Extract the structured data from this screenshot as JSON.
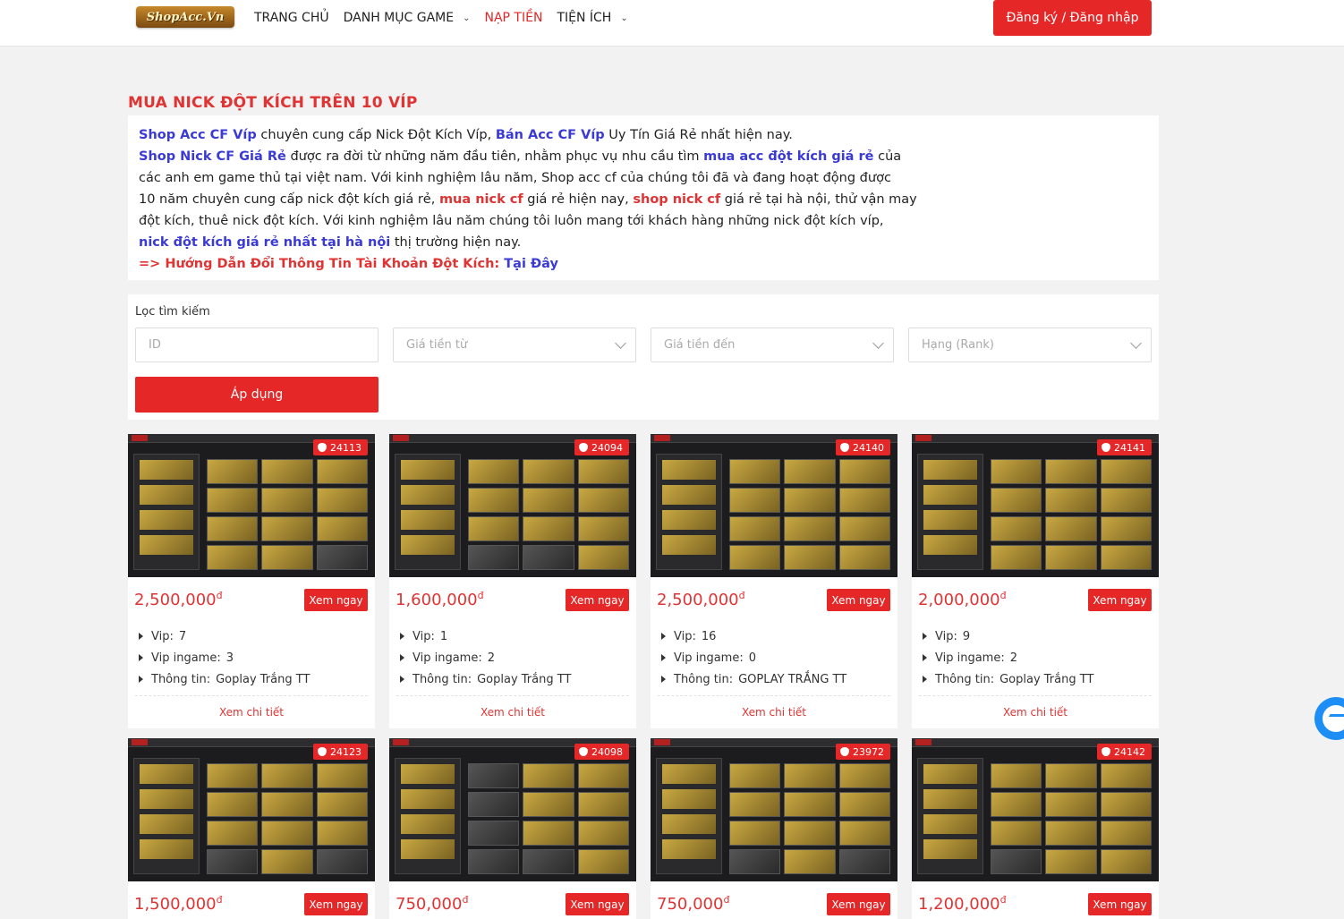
{
  "header": {
    "logo_text": "ShopAcc.Vn",
    "nav": [
      {
        "label": "TRANG CHỦ",
        "has_dropdown": false,
        "active": false
      },
      {
        "label": "DANH MỤC GAME",
        "has_dropdown": true,
        "active": false
      },
      {
        "label": "NẠP TIỀN",
        "has_dropdown": false,
        "active": true
      },
      {
        "label": "TIỆN ÍCH",
        "has_dropdown": true,
        "active": false
      }
    ],
    "login_label": "Đăng ký / Đăng nhập"
  },
  "page_title": "MUA NICK ĐỘT KÍCH TRÊN 10 VÍP",
  "intro": {
    "l1_a": "Shop Acc CF Víp",
    "l1_b": " chuyên cung cấp Nick Đột Kích Víp, ",
    "l1_c": "Bán Acc CF Víp",
    "l1_d": " Uy Tín Giá Rẻ nhất hiện nay.",
    "l2_a": "Shop Nick CF Giá Rẻ",
    "l2_b": " được ra đời từ những năm đầu tiên, nhằm phục vụ nhu cầu tìm ",
    "l2_c": "mua acc đột kích giá rẻ",
    "l2_d": " của",
    "l3": "các anh em game thủ tại việt nam. Với kinh nghiệm lâu năm, Shop acc  cf của chúng tôi đã và đang hoạt động được",
    "l4_a": "10 năm chuyên cung cấp nick đột kích giá rẻ, ",
    "l4_b": "mua nick cf",
    "l4_c": " giá rẻ hiện nay, ",
    "l4_d": "shop nick cf",
    "l4_e": " giá rẻ tại hà nội, thử vận may",
    "l5": "đột kích, thuê nick đột kích. Với kinh nghiệm lâu năm chúng tôi luôn mang tới khách hàng những nick đột kích víp,",
    "l6_a": "nick đột kích giá rẻ nhất tại hà nội",
    "l6_b": "  thị trường hiện nay.",
    "l7_a": "=> Hướng Dẫn Đổi Thông Tin Tài Khoản Đột Kích: ",
    "l7_b": "Tại Đây"
  },
  "filter": {
    "label": "Lọc tìm kiếm",
    "id_placeholder": "ID",
    "price_from": "Giá tiền từ",
    "price_to": "Giá tiền đến",
    "rank": "Hạng (Rank)",
    "apply": "Áp dụng"
  },
  "labels": {
    "vip": "Vip:",
    "vip_ingame": "Vip ingame:",
    "info": "Thông tin:",
    "view_now": "Xem ngay",
    "view_detail": "Xem chi tiết",
    "currency": "đ"
  },
  "cards": [
    {
      "id": "24113",
      "price": "2,500,000",
      "vip": "7",
      "vip_ingame": "3",
      "info": "Goplay Trắng TT"
    },
    {
      "id": "24094",
      "price": "1,600,000",
      "vip": "1",
      "vip_ingame": "2",
      "info": "Goplay Trắng TT"
    },
    {
      "id": "24140",
      "price": "2,500,000",
      "vip": "16",
      "vip_ingame": "0",
      "info": "GOPLAY TRẮNG TT"
    },
    {
      "id": "24141",
      "price": "2,000,000",
      "vip": "9",
      "vip_ingame": "2",
      "info": "Goplay Trắng TT"
    },
    {
      "id": "24123",
      "price": "1,500,000"
    },
    {
      "id": "24098",
      "price": "750,000"
    },
    {
      "id": "23972",
      "price": "750,000"
    },
    {
      "id": "24142",
      "price": "1,200,000"
    }
  ]
}
